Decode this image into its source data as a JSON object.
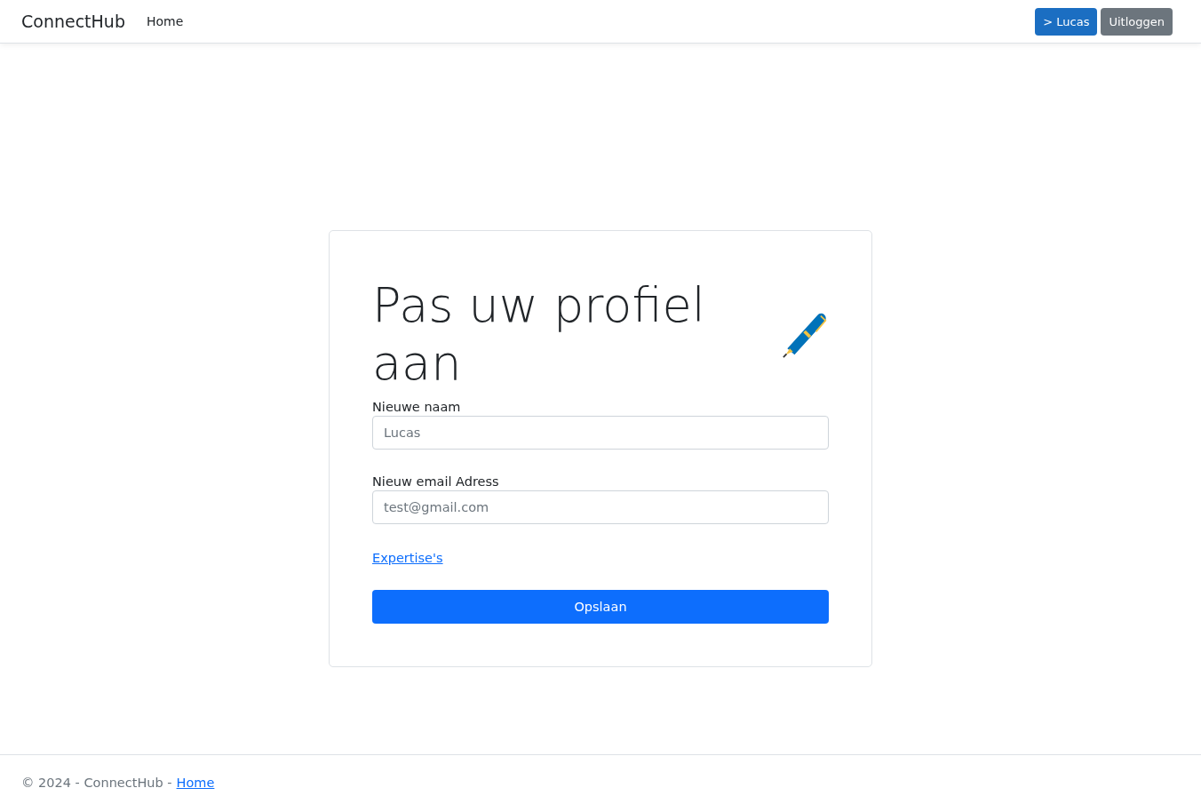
{
  "navbar": {
    "brand": "ConnectHub",
    "links": [
      {
        "label": "Home"
      }
    ],
    "buttons": [
      {
        "label": "> Lucas",
        "kind": "primary"
      },
      {
        "label": "Uitloggen",
        "kind": "secondary"
      }
    ]
  },
  "form": {
    "title": "Pas uw profiel aan",
    "fields": [
      {
        "label": "Nieuwe naam",
        "placeholder": "Lucas"
      },
      {
        "label": "Nieuw email Adress",
        "placeholder": "test@gmail.com"
      }
    ],
    "link": "Expertise's",
    "submit": "Opslaan"
  },
  "footer": {
    "text": "© 2024 - ConnectHub -",
    "link": "Home"
  }
}
